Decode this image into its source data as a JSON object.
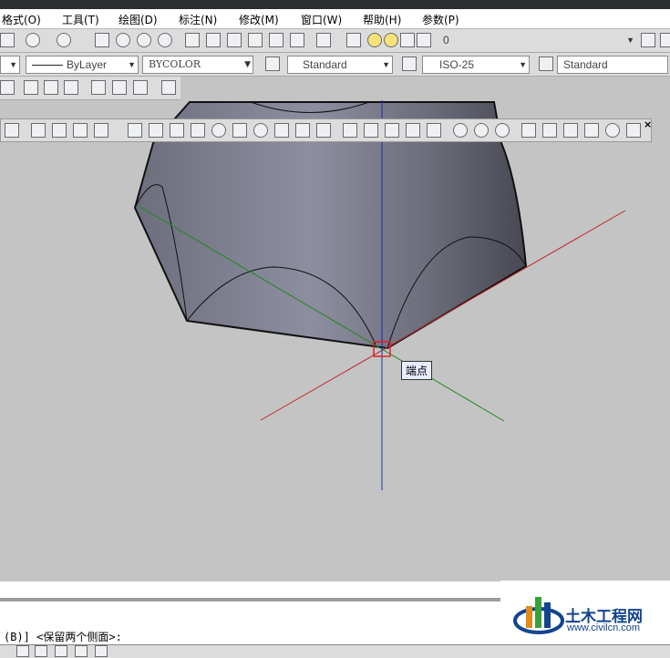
{
  "menubar": {
    "items": [
      "格式(O)",
      "工具(T)",
      "绘图(D)",
      "标注(N)",
      "修改(M)",
      "窗口(W)",
      "帮助(H)",
      "参数(P)"
    ]
  },
  "toolbar1": {
    "layer_name": "0"
  },
  "toolbar2": {
    "linetype": "ByLayer",
    "color": "BYCOLOR",
    "text_style": "Standard",
    "dim_style": "ISO-25",
    "table_style": "Standard"
  },
  "viewport": {
    "tooltip": "端点"
  },
  "command": {
    "prompt": "(B)] <保留两个侧面>:"
  },
  "watermark": {
    "name": "土木工程网",
    "url": "www.civilcn.com"
  },
  "colors": {
    "x_axis": "#c0282e",
    "y_axis": "#1f8a1f",
    "z_axis": "#1c2bb0",
    "snap_marker": "#e02020"
  }
}
